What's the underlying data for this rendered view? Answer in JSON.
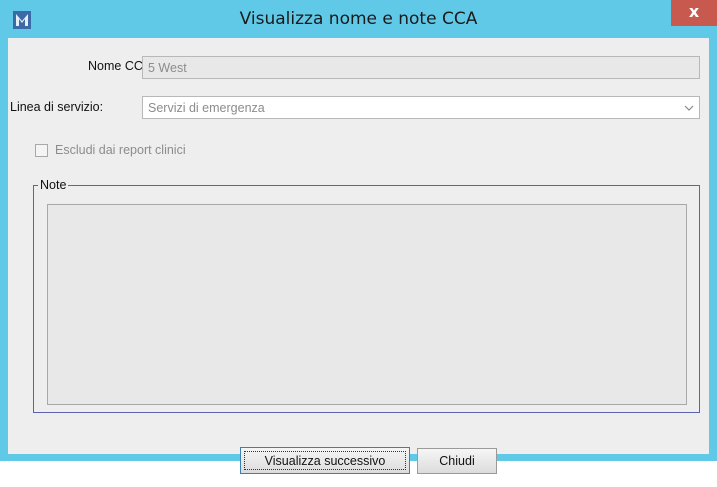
{
  "window": {
    "title": "Visualizza nome e note CCA",
    "close_label": "x",
    "app_icon": "app-logo-icon",
    "accent_color": "#60c9e8"
  },
  "form": {
    "nome_cca_label": "Nome CCA:",
    "nome_cca_value": "5 West",
    "linea_label": "Linea di servizio:",
    "linea_value": "Servizi di emergenza",
    "escludi_label": "Escludi dai report clinici",
    "escludi_checked": false
  },
  "notes": {
    "group_label": "Note",
    "value": ""
  },
  "buttons": {
    "next_label": "Visualizza successivo",
    "close_label": "Chiudi"
  }
}
